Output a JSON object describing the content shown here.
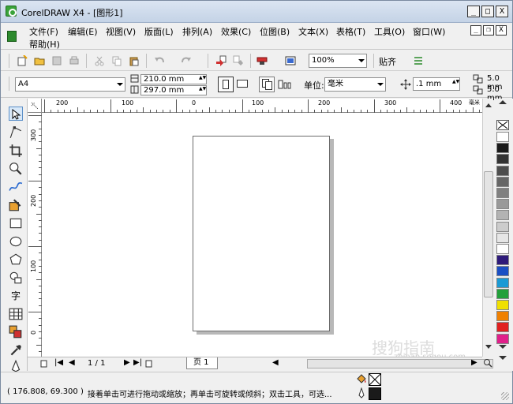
{
  "window": {
    "title": "CorelDRAW X4 - [图形1]",
    "min_label": "_",
    "max_label": "□",
    "close_label": "X",
    "doc_min_label": "_",
    "doc_restore_label": "❐",
    "doc_close_label": "X"
  },
  "menu": {
    "items": [
      "文件(F)",
      "编辑(E)",
      "视图(V)",
      "版面(L)",
      "排列(A)",
      "效果(C)",
      "位图(B)",
      "文本(X)",
      "表格(T)",
      "工具(O)",
      "窗口(W)"
    ],
    "help": "帮助(H)"
  },
  "toolbar": {
    "zoom": "100%",
    "snap_label": "贴齐"
  },
  "properties": {
    "paper": "A4",
    "width": "210.0 mm",
    "height": "297.0 mm",
    "units_label": "单位:",
    "units": "毫米",
    "nudge": ".1 mm",
    "dup_x": "5.0 mm",
    "dup_y": "5.0 mm"
  },
  "rulers": {
    "h_labels": [
      "200",
      "100",
      "0",
      "100",
      "200",
      "300",
      "400"
    ],
    "v_labels": [
      "300",
      "200",
      "100",
      "0"
    ],
    "unit": "毫米"
  },
  "toolbox": {
    "text_tool": "字"
  },
  "pagenav": {
    "counter": "1 / 1",
    "page_tab": "页 1"
  },
  "status": {
    "coords": "( 176.808, 69.300 )",
    "message": "接着单击可进行拖动或缩放；再单击可旋转或倾斜；双击工具，可选..."
  },
  "palette": {
    "colors": [
      "#ffffff",
      "#1a1a1a",
      "#333333",
      "#4d4d4d",
      "#666666",
      "#808080",
      "#999999",
      "#b3b3b3",
      "#cccccc",
      "#e6e6e6",
      "#ffffff",
      "#2e1a7a",
      "#1a4fc4",
      "#1a9ad4",
      "#22a03a",
      "#f0e000",
      "#f08000",
      "#e02020",
      "#e0208a"
    ]
  },
  "watermark": {
    "brand": "搜狗指南",
    "url": "zhinan.sogou.com"
  }
}
